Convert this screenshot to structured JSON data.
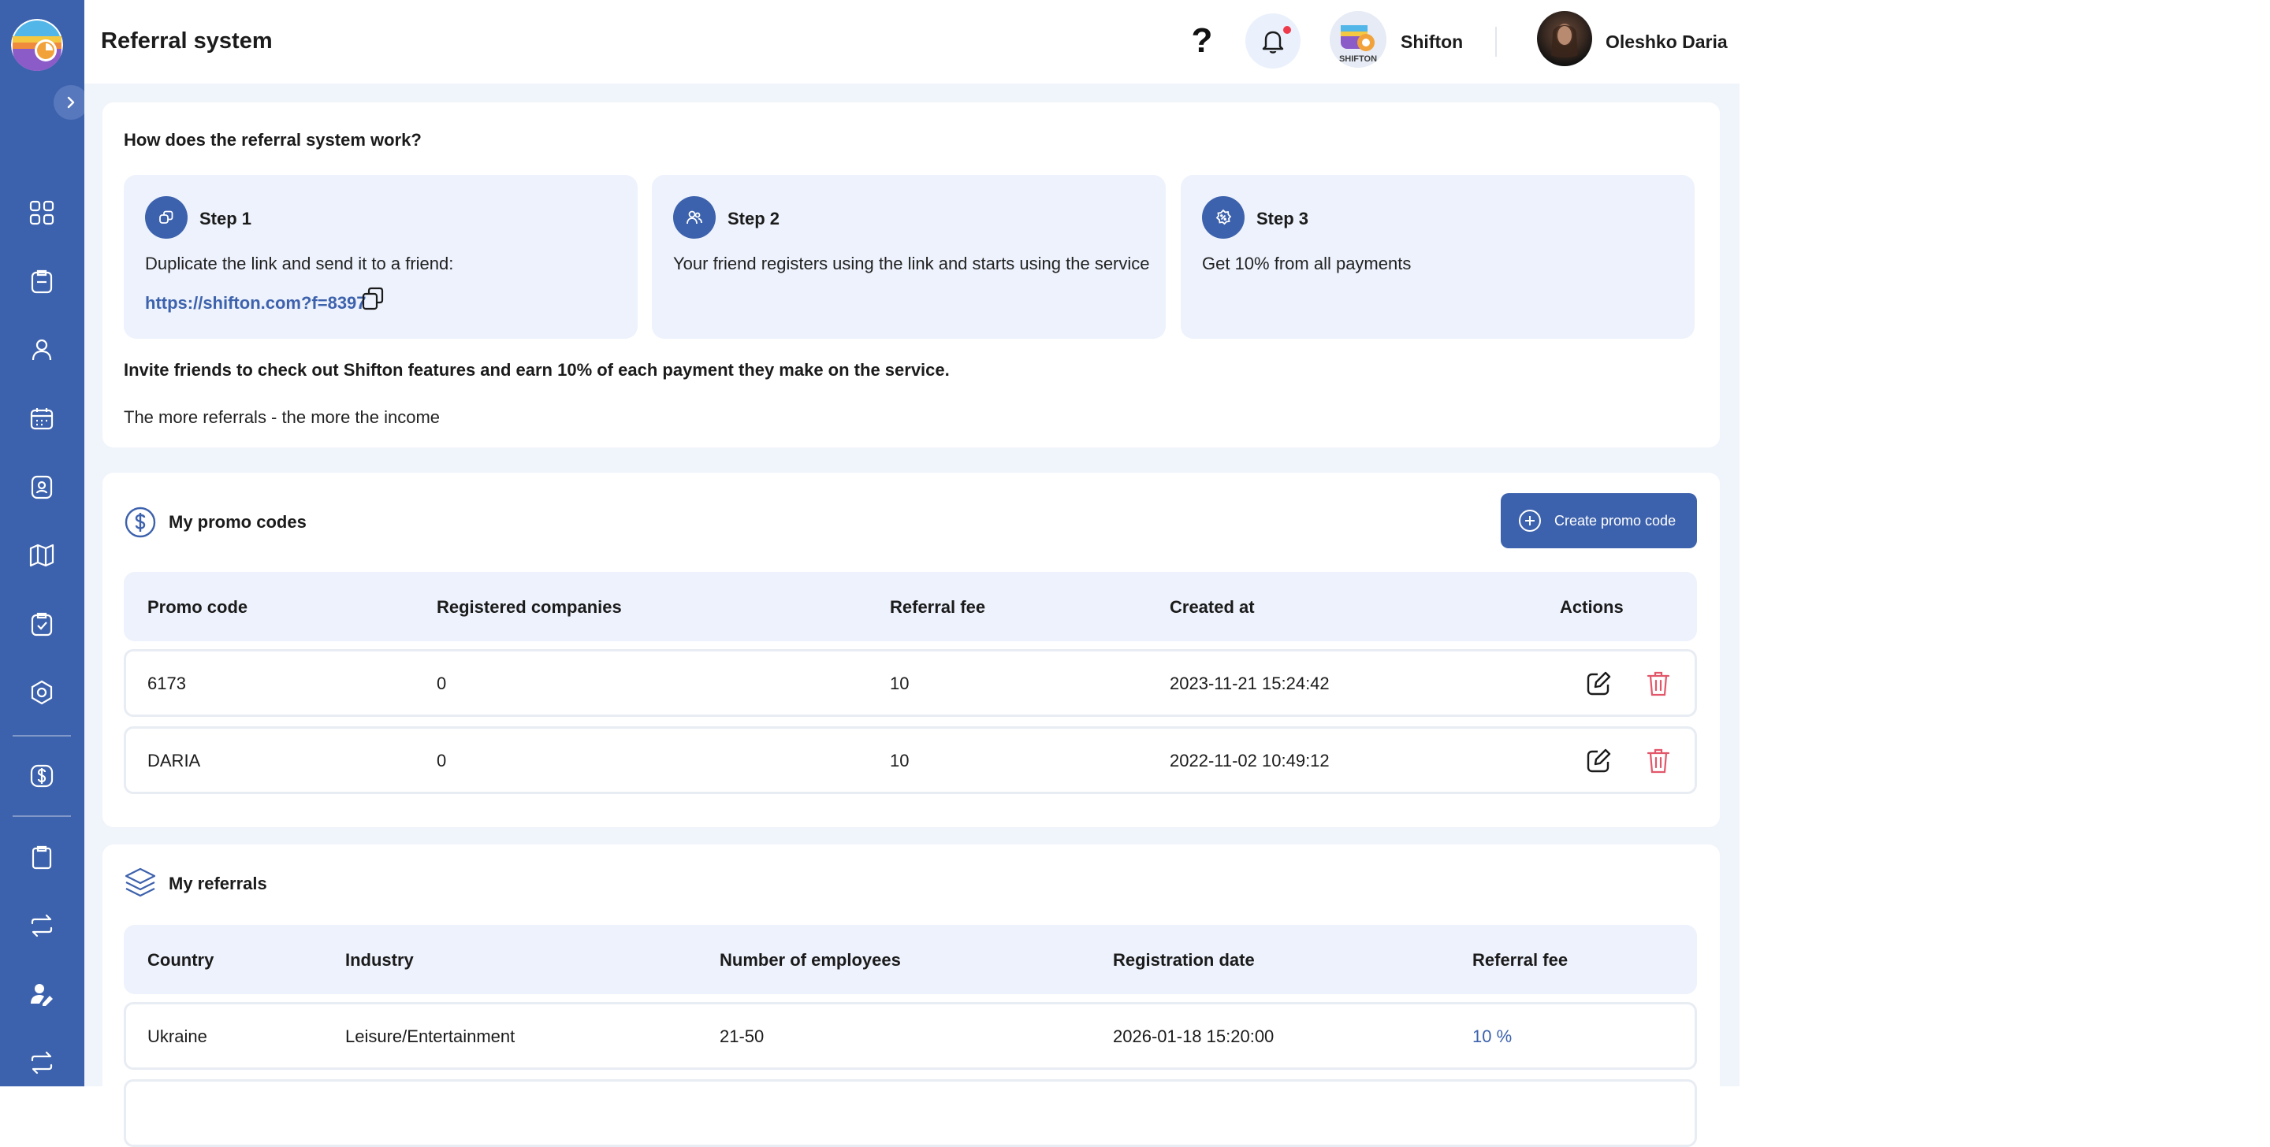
{
  "header": {
    "title": "Referral system",
    "company_name": "Shifton",
    "user_name": "Oleshko Daria",
    "help_symbol": "?",
    "company_logo_text": "SHIFTON"
  },
  "sidebar": {
    "items": [
      {
        "name": "dashboard",
        "icon": "grid-icon"
      },
      {
        "name": "tasks",
        "icon": "clipboard-icon"
      },
      {
        "name": "users",
        "icon": "user-icon"
      },
      {
        "name": "calendar",
        "icon": "calendar-icon"
      },
      {
        "name": "badge",
        "icon": "id-badge-icon"
      },
      {
        "name": "map",
        "icon": "map-icon"
      },
      {
        "name": "checklist",
        "icon": "clipboard-check-icon"
      },
      {
        "name": "settings",
        "icon": "hexagon-settings-icon"
      },
      {
        "name": "payments",
        "icon": "dollar-icon"
      },
      {
        "name": "reports",
        "icon": "notes-icon"
      },
      {
        "name": "exchange",
        "icon": "arrows-icon"
      },
      {
        "name": "account",
        "icon": "user-edit-icon"
      },
      {
        "name": "sync",
        "icon": "arrows-icon"
      }
    ]
  },
  "how": {
    "title": "How does the referral system work?",
    "steps": [
      {
        "title": "Step 1",
        "text": "Duplicate the link and send it to a friend:",
        "link": "https://shifton.com?f=8397"
      },
      {
        "title": "Step 2",
        "text": "Your friend registers using the link and starts using the service"
      },
      {
        "title": "Step 3",
        "text": "Get 10% from all payments"
      }
    ],
    "invite": "Invite friends to check out Shifton features and earn 10% of each payment they make on the service.",
    "more": "The more referrals - the more the income"
  },
  "promo": {
    "title": "My promo codes",
    "create_label": "Create promo code",
    "columns": [
      "Promo code",
      "Registered companies",
      "Referral fee",
      "Created at",
      "Actions"
    ],
    "rows": [
      {
        "code": "6173",
        "companies": "0",
        "fee": "10",
        "created": "2023-11-21 15:24:42"
      },
      {
        "code": "DARIA",
        "companies": "0",
        "fee": "10",
        "created": "2022-11-02 10:49:12"
      }
    ]
  },
  "referrals": {
    "title": "My referrals",
    "columns": [
      "Country",
      "Industry",
      "Number of employees",
      "Registration date",
      "Referral fee"
    ],
    "rows": [
      {
        "country": "Ukraine",
        "industry": "Leisure/Entertainment",
        "employees": "21-50",
        "date": "2026-01-18 15:20:00",
        "fee": "10 %"
      }
    ]
  },
  "colors": {
    "brand": "#3d62ad",
    "background": "#f0f4fb",
    "step_bg": "#edf2fc",
    "delete": "#e2566a",
    "notification_dot": "#ee3a4a"
  }
}
